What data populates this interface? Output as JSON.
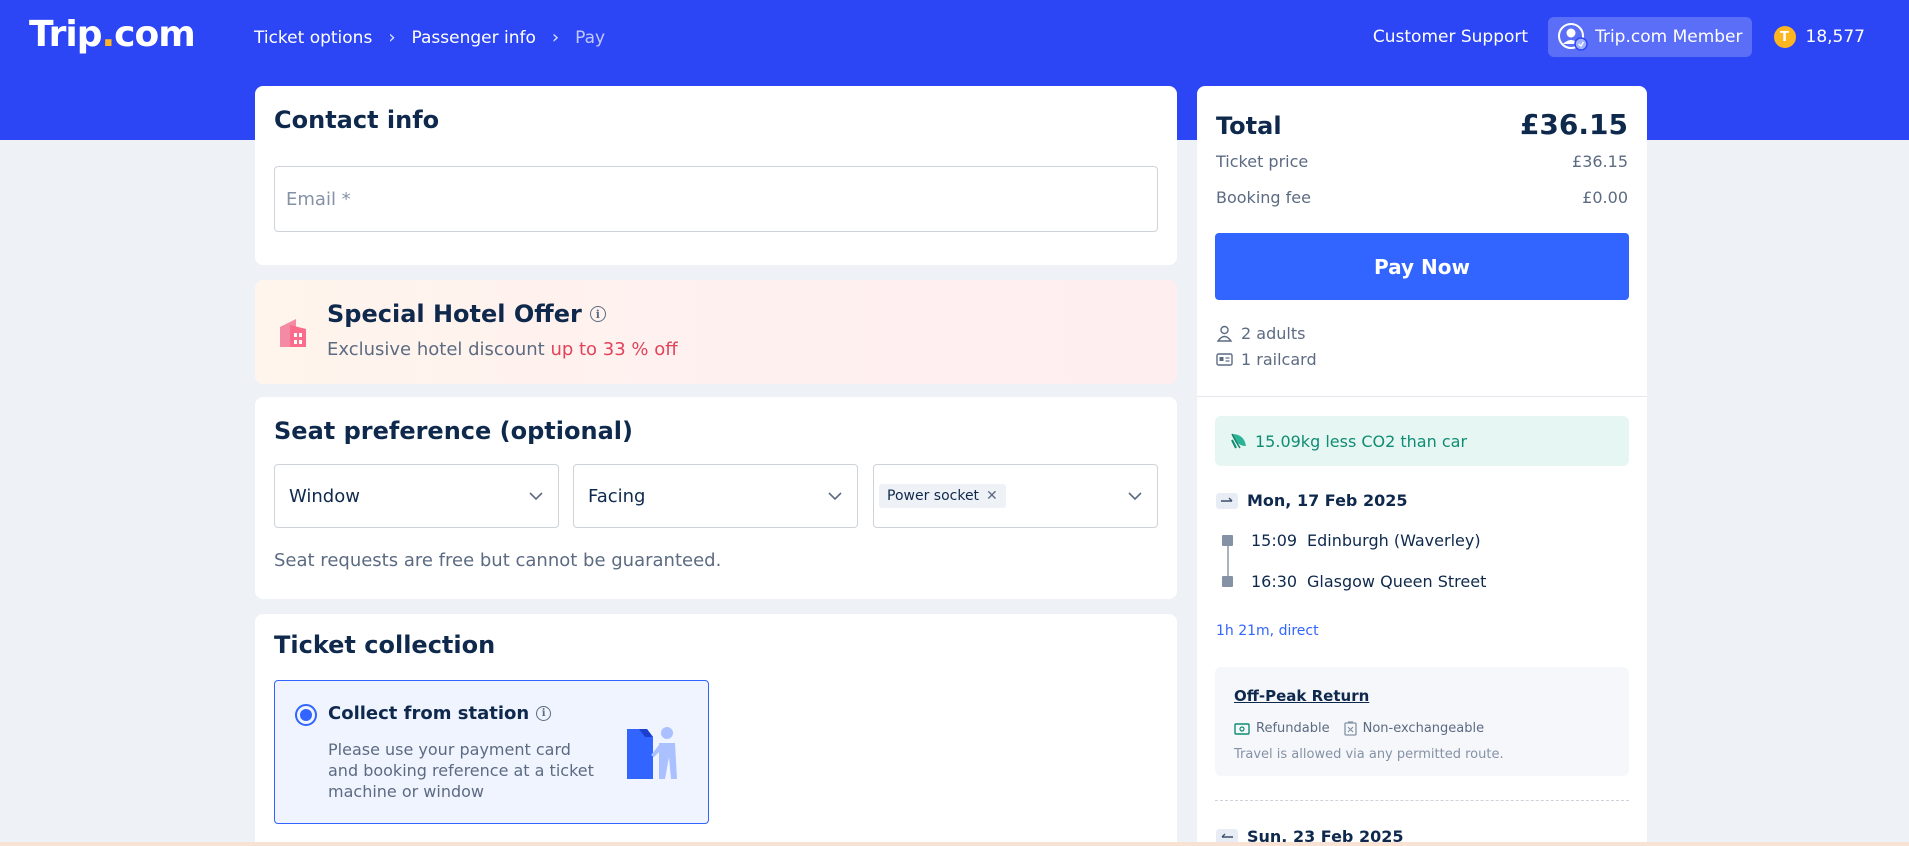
{
  "header": {
    "logo_main": "Trip",
    "logo_dot": ".",
    "logo_tld": "com",
    "breadcrumbs": [
      "Ticket options",
      "Passenger info",
      "Pay"
    ],
    "customer_support": "Customer Support",
    "member_label": "Trip.com Member",
    "coin_symbol": "T",
    "points": "18,577"
  },
  "contact": {
    "title": "Contact info",
    "email_placeholder": "Email *",
    "email_value": ""
  },
  "hotel_offer": {
    "title": "Special Hotel Offer",
    "subtitle_prefix": "Exclusive hotel discount ",
    "subtitle_highlight": "up to 33 % off"
  },
  "seat": {
    "title": "Seat preference (optional)",
    "position_value": "Window",
    "direction_value": "Facing",
    "feature_tag": "Power socket",
    "note": "Seat requests are free but cannot be guaranteed."
  },
  "ticket_collection": {
    "title": "Ticket collection",
    "option_title": "Collect from station",
    "option_desc": "Please use your payment card and booking reference at a ticket machine or window",
    "selected": true
  },
  "summary": {
    "total_label": "Total",
    "total_value": "£36.15",
    "ticket_price_label": "Ticket price",
    "ticket_price_value": "£36.15",
    "booking_fee_label": "Booking fee",
    "booking_fee_value": "£0.00",
    "pay_button": "Pay Now",
    "adults": "2 adults",
    "railcard": "1 railcard",
    "co2_text": "15.09kg less CO2 than car",
    "outbound": {
      "date": "Mon, 17 Feb 2025",
      "depart_time": "15:09",
      "depart_station": "Edinburgh (Waverley)",
      "arrive_time": "16:30",
      "arrive_station": "Glasgow Queen Street",
      "duration": "1h 21m, direct"
    },
    "fare": {
      "name": "Off-Peak Return",
      "refundable": "Refundable",
      "exchange": "Non-exchangeable",
      "note": "Travel is allowed via any permitted route."
    },
    "return": {
      "date": "Sun, 23 Feb 2025"
    }
  },
  "colors": {
    "brand_blue": "#2d46f5",
    "button_blue": "#3264ff",
    "highlight_red": "#e2435a",
    "eco_green": "#0f8c73",
    "coin_gold": "#ffb51f"
  }
}
